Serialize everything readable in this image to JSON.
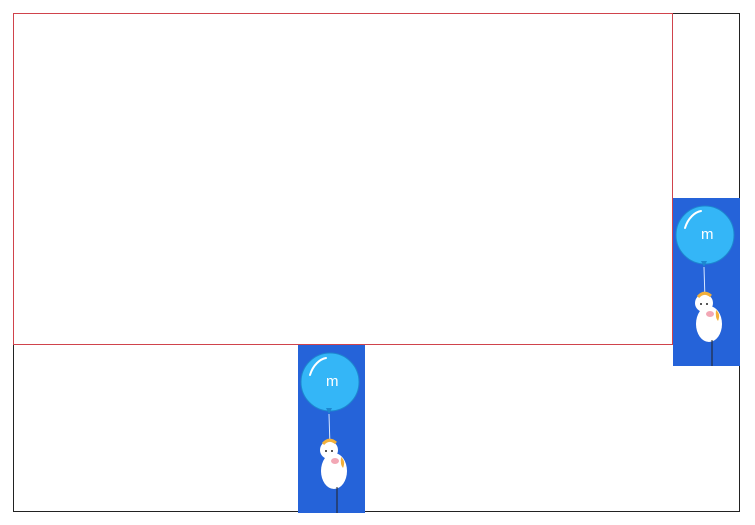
{
  "layout_regions": {
    "outer_frame": "outer-frame",
    "inner_frame": "inner-frame"
  },
  "ads": [
    {
      "id": "right",
      "balloon_letter": "m",
      "icon": "balloon-icon",
      "character_icon": "character-icon"
    },
    {
      "id": "bottom",
      "balloon_letter": "m",
      "icon": "balloon-icon",
      "character_icon": "character-icon"
    }
  ],
  "colors": {
    "ad_background": "#2563d9",
    "balloon": "#34b6f7",
    "inner_frame_border": "#d0434c",
    "outer_frame_border": "#222222"
  }
}
